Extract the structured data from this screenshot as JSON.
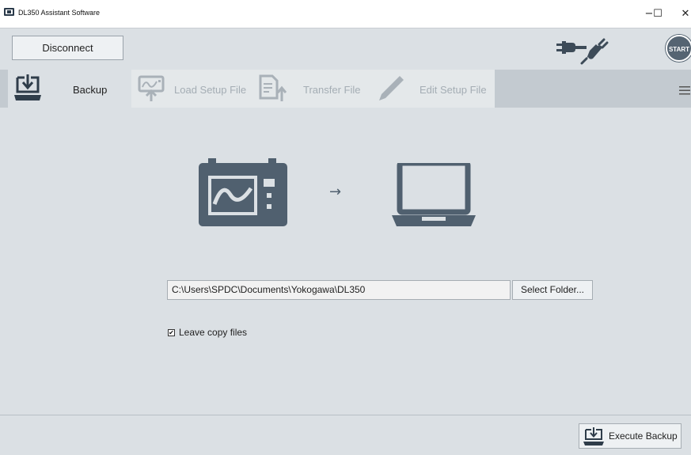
{
  "window": {
    "title": "DL350 Assistant Software",
    "minimize_glyph": "−",
    "maximize_glyph": "☐",
    "close_glyph": "✕"
  },
  "toolbar": {
    "disconnect_label": "Disconnect",
    "start_label": "START",
    "icons": [
      "plug-icon",
      "cable-icon"
    ]
  },
  "tabs": [
    {
      "label": "Backup",
      "icon": "backup-icon",
      "state": "active"
    },
    {
      "label": "Load Setup File",
      "icon": "load-setup-icon",
      "state": "disabled"
    },
    {
      "label": "Transfer File",
      "icon": "transfer-file-icon",
      "state": "disabled"
    },
    {
      "label": "Edit Setup File",
      "icon": "edit-pencil-icon",
      "state": "disabled"
    }
  ],
  "main": {
    "arrow": "→",
    "folder_path": "C:\\Users\\SPDC\\Documents\\Yokogawa\\DL350",
    "select_folder_label": "Select Folder...",
    "leave_copy": {
      "checked": true,
      "mark": "✔",
      "label": "Leave copy files"
    }
  },
  "footer": {
    "execute_label": "Execute Backup"
  },
  "colors": {
    "background": "#dbe0e4",
    "tab_strip": "#c3cad0",
    "illustration": "#50606f",
    "disabled_text": "#a4adb4"
  }
}
